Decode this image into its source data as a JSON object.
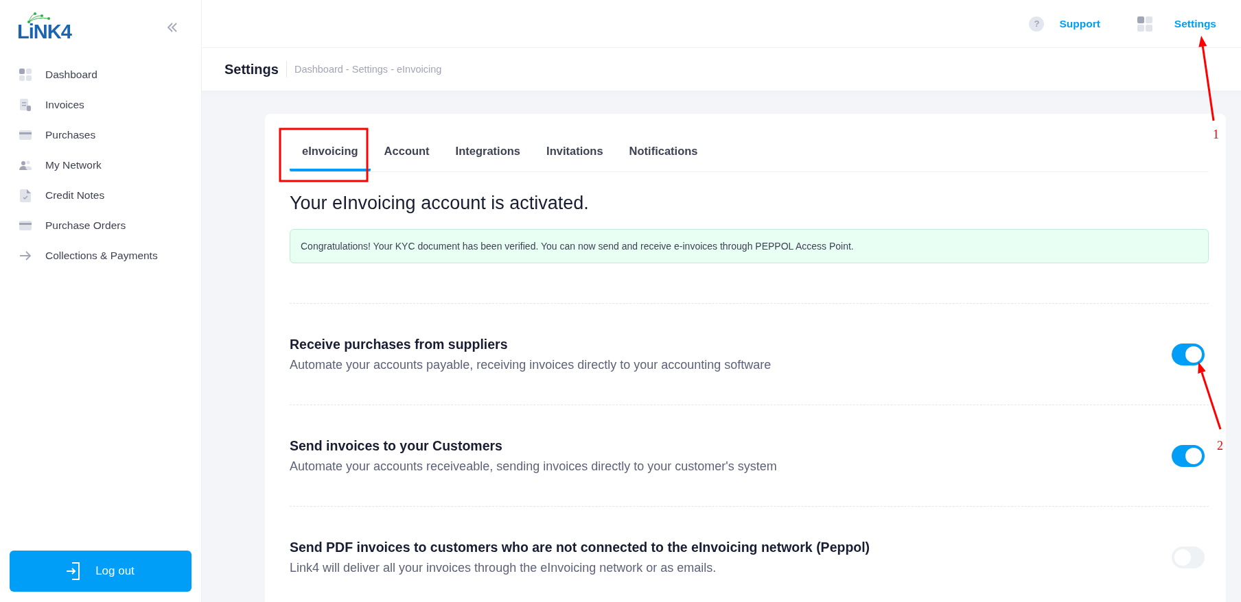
{
  "sidebar": {
    "logo": "LiNK4",
    "items": [
      {
        "label": "Dashboard"
      },
      {
        "label": "Invoices"
      },
      {
        "label": "Purchases"
      },
      {
        "label": "My Network"
      },
      {
        "label": "Credit Notes"
      },
      {
        "label": "Purchase Orders"
      },
      {
        "label": "Collections & Payments"
      }
    ],
    "logout": "Log out"
  },
  "top_bar": {
    "help": "?",
    "support": "Support",
    "settings": "Settings"
  },
  "page_header": {
    "title": "Settings",
    "breadcrumb": "Dashboard - Settings - eInvoicing"
  },
  "tabs": [
    {
      "label": "eInvoicing",
      "selected": true
    },
    {
      "label": "Account",
      "selected": false
    },
    {
      "label": "Integrations",
      "selected": false
    },
    {
      "label": "Invitations",
      "selected": false
    },
    {
      "label": "Notifications",
      "selected": false
    }
  ],
  "heading": "Your eInvoicing account is activated.",
  "alert": "Congratulations! Your KYC document has been verified. You can now send and receive e-invoices through PEPPOL Access Point.",
  "settings": [
    {
      "title": "Receive purchases from suppliers",
      "description": "Automate your accounts payable, receiving invoices directly to your accounting software",
      "on": true
    },
    {
      "title": "Send invoices to your Customers",
      "description": "Automate your accounts receiveable, sending invoices directly to your customer's system",
      "on": true
    },
    {
      "title": "Send PDF invoices to customers who are not connected to the eInvoicing network (Peppol)",
      "description": "Link4 will deliver all your invoices through the eInvoicing network or as emails.",
      "on": false
    }
  ],
  "annotations": [
    {
      "kind": "box"
    },
    {
      "kind": "arrow",
      "label": "1"
    },
    {
      "kind": "arrow",
      "label": "2"
    }
  ]
}
